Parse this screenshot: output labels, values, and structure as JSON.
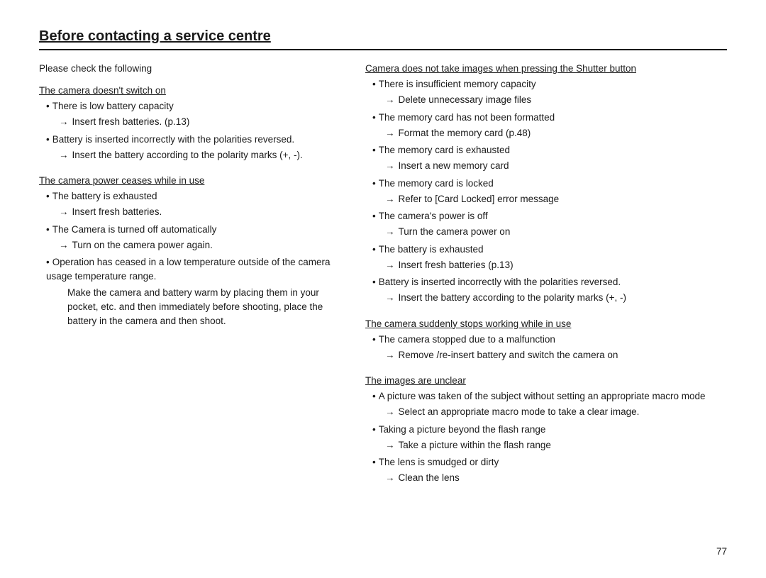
{
  "page": {
    "title": "Before contacting a service centre",
    "page_number": "77"
  },
  "left_column": {
    "intro": "Please check the following",
    "sections": [
      {
        "id": "section-camera-switch",
        "title": "The camera doesn't switch on",
        "items": [
          {
            "type": "bullet",
            "text": "There is low battery capacity"
          },
          {
            "type": "arrow",
            "text": "Insert fresh batteries.  (p.13)"
          },
          {
            "type": "bullet",
            "text": "Battery is inserted incorrectly with the polarities reversed."
          },
          {
            "type": "arrow",
            "text": "Insert the battery according to the polarity marks (+, -)."
          }
        ]
      },
      {
        "id": "section-camera-power",
        "title": "The camera power ceases while in use",
        "items": [
          {
            "type": "bullet",
            "text": "The battery is exhausted"
          },
          {
            "type": "arrow",
            "text": "Insert fresh batteries."
          },
          {
            "type": "bullet",
            "text": "The Camera is turned off automatically"
          },
          {
            "type": "arrow",
            "text": "Turn on the camera power again."
          },
          {
            "type": "bullet",
            "text": "Operation has ceased in a low temperature outside of the camera usage temperature range."
          },
          {
            "type": "arrow_indent",
            "text": "Make the camera and battery warm by placing them in your pocket, etc. and then immediately before shooting, place the battery in the camera and then shoot."
          }
        ]
      }
    ]
  },
  "right_column": {
    "sections": [
      {
        "id": "section-shutter",
        "title": "Camera does not take images when pressing the Shutter button",
        "items": [
          {
            "type": "bullet",
            "text": "There is insufficient memory capacity"
          },
          {
            "type": "arrow",
            "text": "Delete unnecessary image files"
          },
          {
            "type": "bullet",
            "text": "The memory card has not been formatted"
          },
          {
            "type": "arrow",
            "text": "Format the memory card (p.48)"
          },
          {
            "type": "bullet",
            "text": "The memory card is exhausted"
          },
          {
            "type": "arrow",
            "text": "Insert a new memory card"
          },
          {
            "type": "bullet",
            "text": "The memory card is locked"
          },
          {
            "type": "arrow",
            "text": "Refer to [Card Locked] error message"
          },
          {
            "type": "bullet",
            "text": "The camera's power is off"
          },
          {
            "type": "arrow",
            "text": "Turn the camera power on"
          },
          {
            "type": "bullet",
            "text": "The battery is exhausted"
          },
          {
            "type": "arrow",
            "text": "Insert fresh batteries (p.13)"
          },
          {
            "type": "bullet",
            "text": "Battery is inserted incorrectly with the polarities reversed."
          },
          {
            "type": "arrow",
            "text": "Insert the battery according to the polarity marks (+, -)"
          }
        ]
      },
      {
        "id": "section-stops",
        "title": "The camera suddenly stops working while in use",
        "items": [
          {
            "type": "bullet",
            "text": "The camera stopped due to a malfunction"
          },
          {
            "type": "arrow",
            "text": "Remove /re-insert battery and switch the camera on"
          }
        ]
      },
      {
        "id": "section-unclear",
        "title": "The images are unclear",
        "items": [
          {
            "type": "bullet",
            "text": "A picture was taken of the subject without setting an appropriate macro mode"
          },
          {
            "type": "arrow",
            "text": "Select an appropriate macro mode to take a clear image."
          },
          {
            "type": "bullet",
            "text": "Taking a picture beyond the flash range"
          },
          {
            "type": "arrow",
            "text": "Take a picture within the flash range"
          },
          {
            "type": "bullet",
            "text": "The lens is smudged or dirty"
          },
          {
            "type": "arrow",
            "text": "Clean the lens"
          }
        ]
      }
    ]
  }
}
